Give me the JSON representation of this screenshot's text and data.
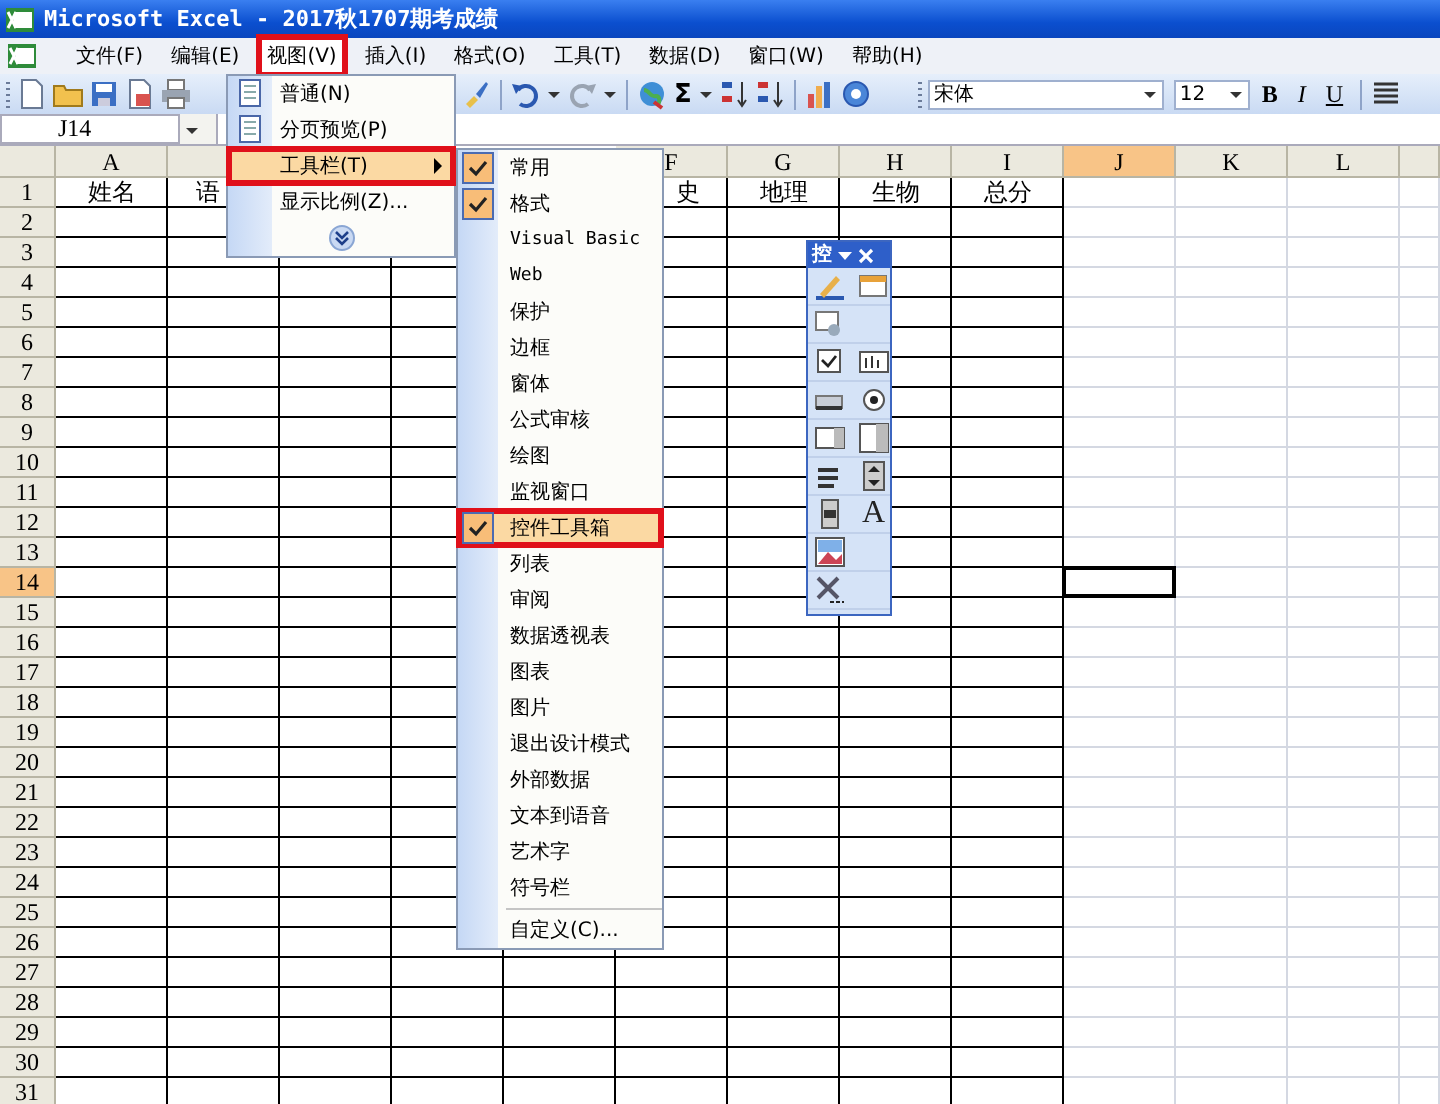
{
  "window": {
    "title": "Microsoft Excel - 2017秋1707期考成绩"
  },
  "menu_bar": [
    {
      "label": "文件(F)",
      "highlighted": false
    },
    {
      "label": "编辑(E)",
      "highlighted": false
    },
    {
      "label": "视图(V)",
      "highlighted": true
    },
    {
      "label": "插入(I)",
      "highlighted": false
    },
    {
      "label": "格式(O)",
      "highlighted": false
    },
    {
      "label": "工具(T)",
      "highlighted": false
    },
    {
      "label": "数据(D)",
      "highlighted": false
    },
    {
      "label": "窗口(W)",
      "highlighted": false
    },
    {
      "label": "帮助(H)",
      "highlighted": false
    }
  ],
  "toolbar": {
    "sum_glyph": "Σ",
    "font": "宋体",
    "font_size": "12",
    "format_buttons": [
      "B",
      "I",
      "U"
    ]
  },
  "name_box": "J14",
  "view_menu": {
    "items": [
      {
        "kind": "icon_item",
        "label": "普通(N)",
        "highlighted": false
      },
      {
        "kind": "icon_item",
        "label": "分页预览(P)",
        "highlighted": false
      },
      {
        "kind": "submenu",
        "label": "工具栏(T)",
        "highlighted": true
      },
      {
        "kind": "item",
        "label": "显示比例(Z)...",
        "highlighted": false
      },
      {
        "kind": "expand",
        "highlighted": false
      }
    ]
  },
  "toolbars_submenu": {
    "items": [
      {
        "label": "常用",
        "checked": true,
        "highlighted": false
      },
      {
        "label": "格式",
        "checked": true,
        "highlighted": false
      },
      {
        "label": "Visual Basic",
        "checked": false,
        "highlighted": false
      },
      {
        "label": "Web",
        "checked": false,
        "highlighted": false
      },
      {
        "label": "保护",
        "checked": false,
        "highlighted": false
      },
      {
        "label": "边框",
        "checked": false,
        "highlighted": false
      },
      {
        "label": "窗体",
        "checked": false,
        "highlighted": false
      },
      {
        "label": "公式审核",
        "checked": false,
        "highlighted": false
      },
      {
        "label": "绘图",
        "checked": false,
        "highlighted": false
      },
      {
        "label": "监视窗口",
        "checked": false,
        "highlighted": false
      },
      {
        "label": "控件工具箱",
        "checked": true,
        "highlighted": true
      },
      {
        "label": "列表",
        "checked": false,
        "highlighted": false
      },
      {
        "label": "审阅",
        "checked": false,
        "highlighted": false
      },
      {
        "label": "数据透视表",
        "checked": false,
        "highlighted": false
      },
      {
        "label": "图表",
        "checked": false,
        "highlighted": false
      },
      {
        "label": "图片",
        "checked": false,
        "highlighted": false
      },
      {
        "label": "退出设计模式",
        "checked": false,
        "highlighted": false
      },
      {
        "label": "外部数据",
        "checked": false,
        "highlighted": false
      },
      {
        "label": "文本到语音",
        "checked": false,
        "highlighted": false
      },
      {
        "label": "艺术字",
        "checked": false,
        "highlighted": false
      },
      {
        "label": "符号栏",
        "checked": false,
        "highlighted": false
      },
      {
        "label": "自定义(C)...",
        "checked": false,
        "highlighted": false,
        "separator_before": true
      }
    ]
  },
  "sheet": {
    "columns": [
      {
        "label": "A",
        "selected": false,
        "bordered": true,
        "row_1": {
          "text": "姓名",
          "kind": "whole"
        }
      },
      {
        "selected": false,
        "bordered": true,
        "row_1": {
          "text": "语",
          "kind": "cut_start"
        }
      },
      {
        "bordered": true
      },
      {
        "bordered": true
      },
      {
        "bordered": true
      },
      {
        "label": "F",
        "selected": false,
        "bordered": true,
        "row_1": {
          "text": "史",
          "kind": "cut_end"
        }
      },
      {
        "label": "G",
        "selected": false,
        "bordered": true,
        "row_1": {
          "text": "地理",
          "kind": "whole"
        }
      },
      {
        "label": "H",
        "selected": false,
        "bordered": true,
        "row_1": {
          "text": "生物",
          "kind": "whole"
        }
      },
      {
        "label": "I",
        "selected": false,
        "bordered": true,
        "row_1": {
          "text": "总分",
          "kind": "whole"
        }
      },
      {
        "label": "J",
        "selected": true,
        "bordered": false
      },
      {
        "label": "K",
        "selected": false,
        "bordered": false
      },
      {
        "label": "L",
        "selected": false,
        "bordered": false
      },
      {
        "selected": false,
        "bordered": false
      }
    ],
    "rows": [
      {
        "label": "1",
        "selected": false
      },
      {
        "label": "2",
        "selected": false
      },
      {
        "label": "3",
        "selected": false
      },
      {
        "label": "4",
        "selected": false
      },
      {
        "label": "5",
        "selected": false
      },
      {
        "label": "6",
        "selected": false
      },
      {
        "label": "7",
        "selected": false
      },
      {
        "label": "8",
        "selected": false
      },
      {
        "label": "9",
        "selected": false
      },
      {
        "label": "10",
        "selected": false
      },
      {
        "label": "11",
        "selected": false
      },
      {
        "label": "12",
        "selected": false
      },
      {
        "label": "13",
        "selected": false
      },
      {
        "label": "14",
        "selected": true
      },
      {
        "label": "15",
        "selected": false
      },
      {
        "label": "16",
        "selected": false
      },
      {
        "label": "17",
        "selected": false
      },
      {
        "label": "18",
        "selected": false
      },
      {
        "label": "19",
        "selected": false
      },
      {
        "label": "20",
        "selected": false
      },
      {
        "label": "21",
        "selected": false
      },
      {
        "label": "22",
        "selected": false
      },
      {
        "label": "23",
        "selected": false
      },
      {
        "label": "24",
        "selected": false
      },
      {
        "label": "25",
        "selected": false
      },
      {
        "label": "26",
        "selected": false
      },
      {
        "label": "27",
        "selected": false
      },
      {
        "label": "28",
        "selected": false
      },
      {
        "label": "29",
        "selected": false
      },
      {
        "label": "30",
        "selected": false
      },
      {
        "label": "31",
        "selected": false
      }
    ]
  },
  "controls_toolbox": {
    "title": "控",
    "label_glyph": "A"
  }
}
